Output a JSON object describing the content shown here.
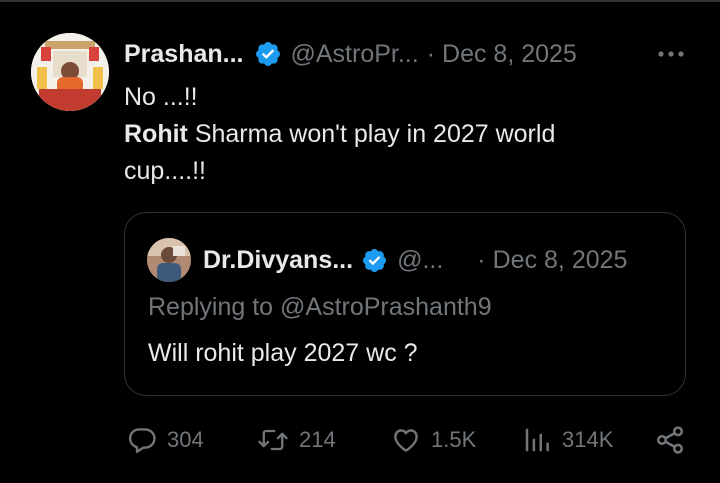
{
  "tweet": {
    "author_name": "Prashan...",
    "author_handle": "@AstroPr...",
    "separator": "·",
    "date": "Dec 8, 2025",
    "text_line1": "No ...!!",
    "text_bold": "Rohit",
    "text_line2_rest": " Sharma won't play in 2027 world",
    "text_line3": "cup....!!"
  },
  "quote": {
    "author_name": "Dr.Divyans...",
    "author_handle": "@...",
    "separator": "·",
    "date": "Dec 8, 2025",
    "replying_to": "Replying to @AstroPrashanth9",
    "text": "Will rohit play 2027 wc ?"
  },
  "actions": {
    "replies": "304",
    "reposts": "214",
    "likes": "1.5K",
    "views": "314K"
  },
  "icons": {
    "more": "more-options-icon",
    "verified": "verified-badge-icon",
    "reply": "reply-icon",
    "repost": "repost-icon",
    "like": "like-icon",
    "views": "views-icon",
    "share": "share-icon"
  },
  "colors": {
    "background": "#000000",
    "text_primary": "#e7e9ea",
    "text_secondary": "#71767b",
    "verified_blue": "#1d9bf0",
    "border": "#2f3336"
  }
}
